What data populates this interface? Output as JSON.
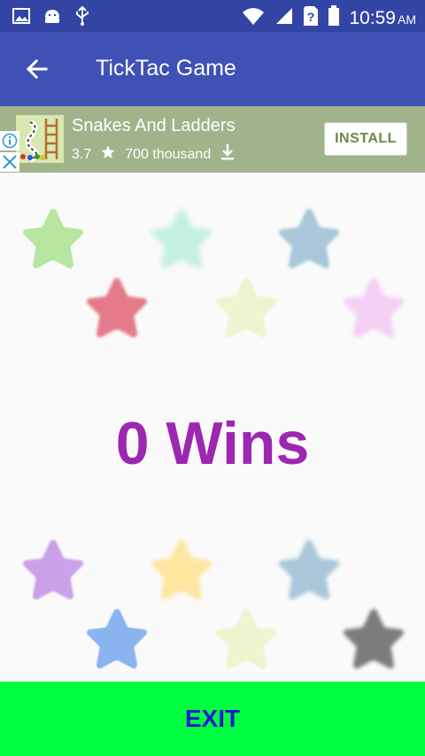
{
  "status_bar": {
    "time": "10:59",
    "ampm": "AM"
  },
  "app_bar": {
    "title": "TickTac Game"
  },
  "ad": {
    "app_name": "Snakes And Ladders",
    "rating": "3.7",
    "downloads": "700 thousand",
    "install_label": "INSTALL"
  },
  "game": {
    "wins_text": "0 Wins",
    "wins_color": "#9c27b0",
    "exit_label": "EXIT"
  },
  "stars": [
    {
      "color": "#b8e6a0",
      "blur": 0
    },
    {
      "color": "#c6f0e0",
      "blur": 3
    },
    {
      "color": "#a9c7d8",
      "blur": 1.5
    },
    {
      "color": "#e57a8a",
      "blur": 1.5
    },
    {
      "color": "#eef3d0",
      "blur": 1
    },
    {
      "color": "#f5d0f5",
      "blur": 2
    },
    {
      "color": "#caa0e8",
      "blur": 1
    },
    {
      "color": "#fde6a0",
      "blur": 2
    },
    {
      "color": "#a9c7d8",
      "blur": 2
    },
    {
      "color": "#8ab4f0",
      "blur": 0.5
    },
    {
      "color": "#eef3d0",
      "blur": 1
    },
    {
      "color": "#7c7c7c",
      "blur": 2
    }
  ]
}
